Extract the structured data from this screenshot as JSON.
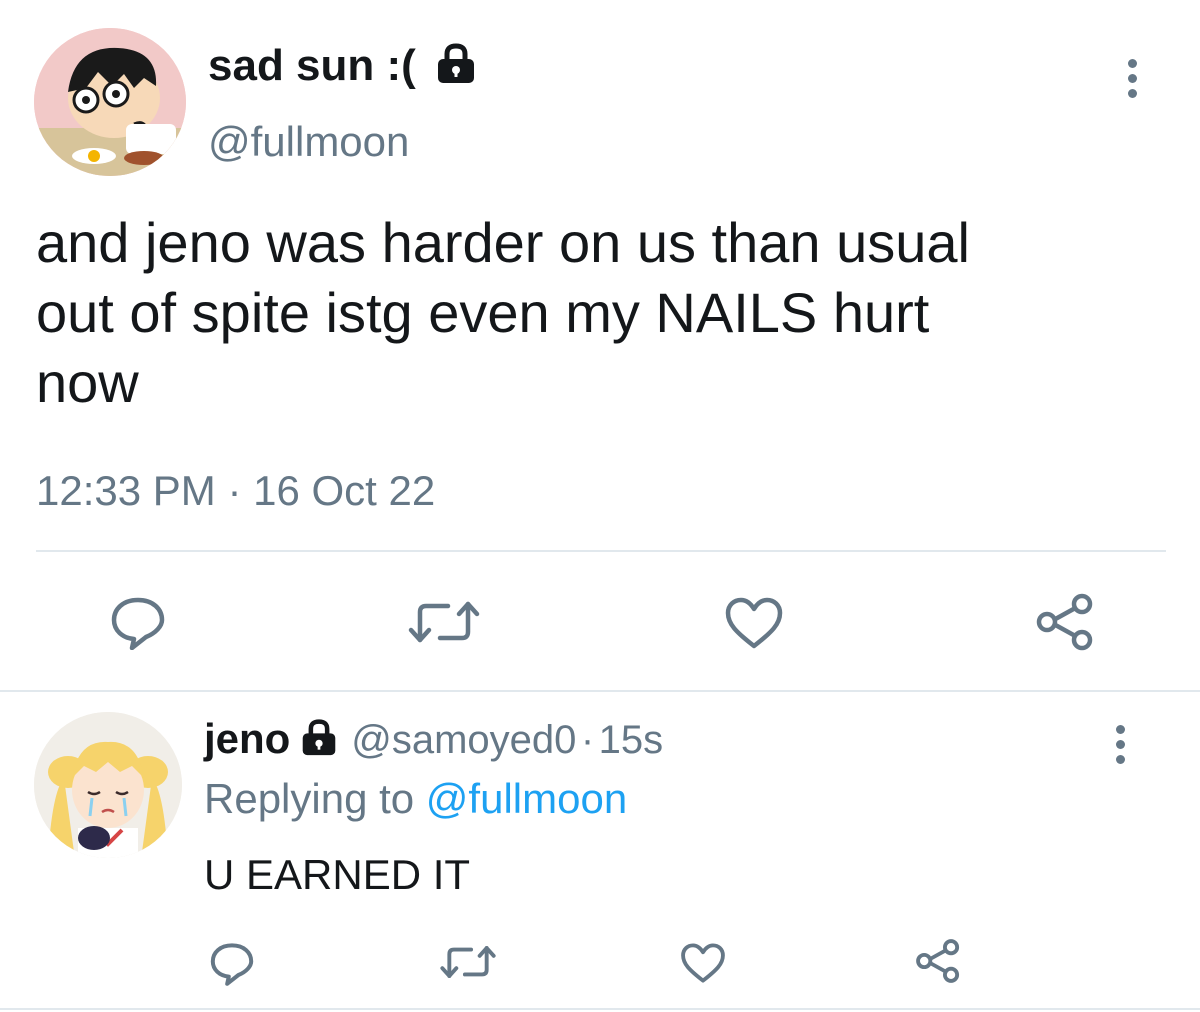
{
  "tweet": {
    "display_name": "sad sun :(",
    "handle": "@fullmoon",
    "text": "and jeno was harder on us than usual\nout of spite istg even my NAILS hurt\nnow",
    "time": "12:33 PM",
    "separator": "·",
    "date": "16 Oct 22",
    "protected_icon": "lock-icon",
    "more_icon": "more-vertical-icon",
    "actions": [
      "reply-icon",
      "retweet-icon",
      "like-icon",
      "share-icon"
    ]
  },
  "reply": {
    "display_name": "jeno",
    "handle": "@samoyed0",
    "separator": "·",
    "age": "15s",
    "replying_prefix": "Replying to",
    "replying_to": "@fullmoon",
    "text": "U EARNED IT",
    "protected_icon": "lock-icon",
    "more_icon": "more-vertical-icon",
    "actions": [
      "reply-icon",
      "retweet-icon",
      "like-icon",
      "share-icon"
    ]
  },
  "colors": {
    "text_primary": "#14171a",
    "text_secondary": "#657786",
    "mention_blue": "#1da1f2",
    "divider": "#e1e8ed"
  }
}
